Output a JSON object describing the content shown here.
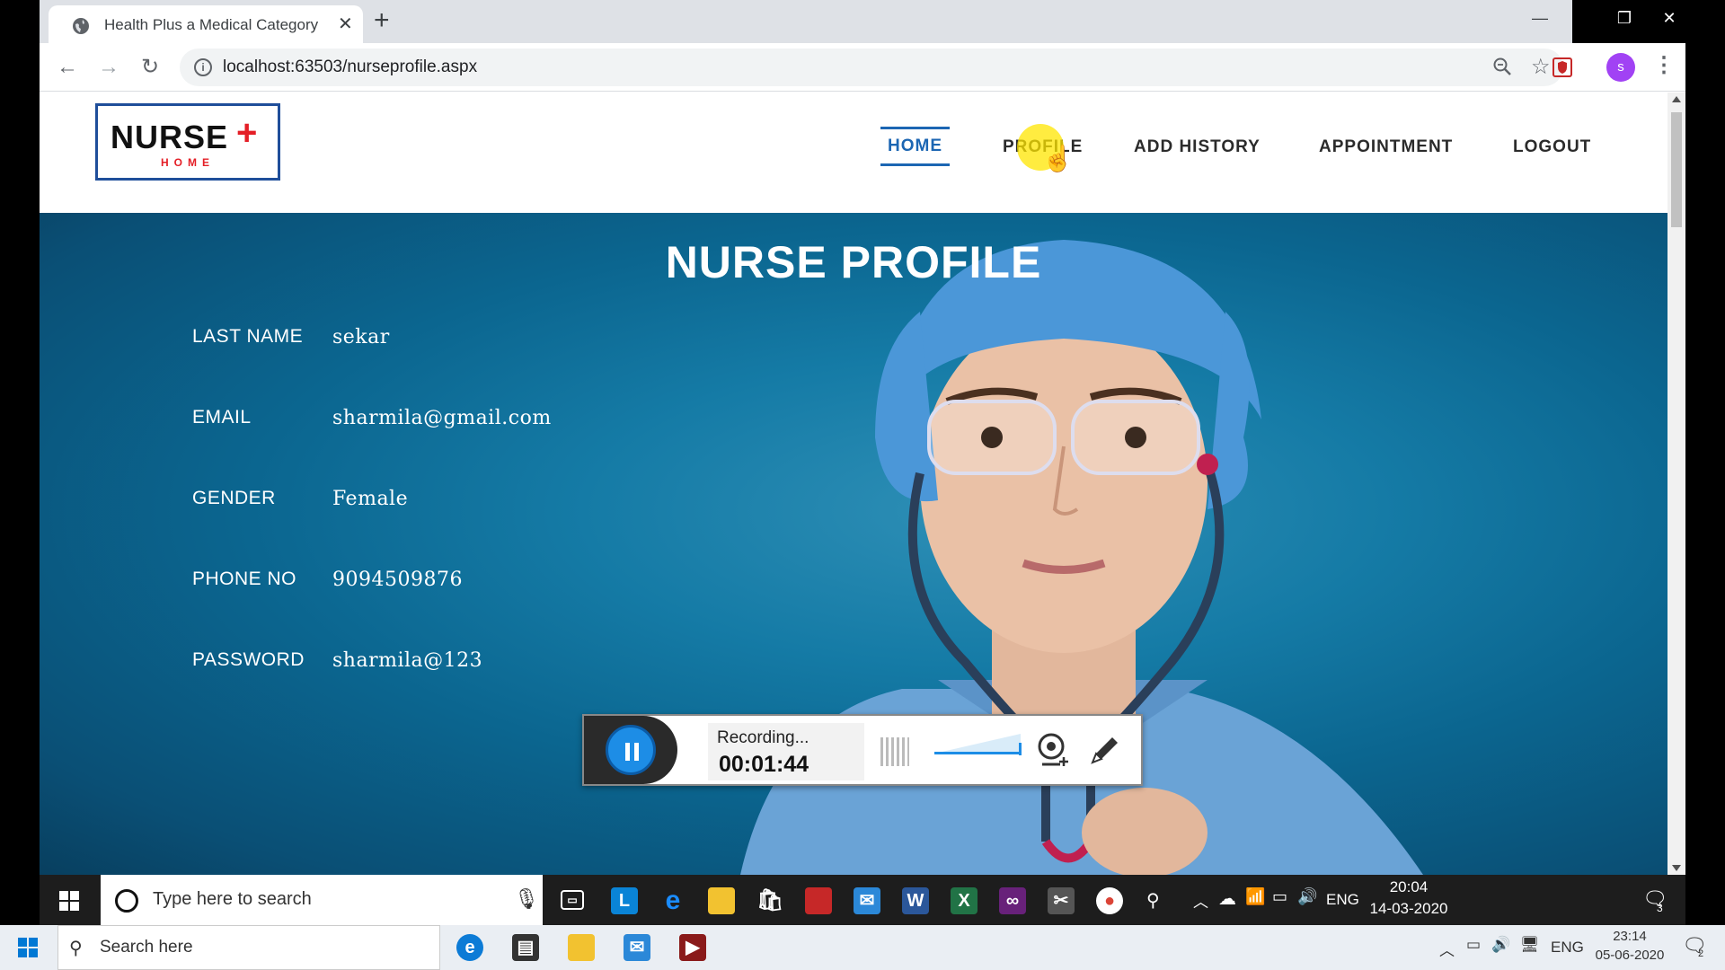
{
  "browser": {
    "tab_title": "Health Plus a Medical Category E",
    "url": "localhost:63503/nurseprofile.aspx",
    "avatar_letter": "s",
    "minimize": "—",
    "maximize": "❐",
    "close": "✕",
    "new_tab": "+",
    "tab_close": "✕"
  },
  "logo": {
    "word": "NURSE",
    "cross": "+",
    "sub": "HOME"
  },
  "nav": {
    "items": [
      {
        "label": "HOME",
        "active": true
      },
      {
        "label": "PROFILE"
      },
      {
        "label": "ADD HISTORY"
      },
      {
        "label": "APPOINTMENT"
      },
      {
        "label": "LOGOUT"
      }
    ]
  },
  "profile": {
    "title": "NURSE PROFILE",
    "fields": [
      {
        "label": "LAST NAME",
        "value": "sekar"
      },
      {
        "label": "EMAIL",
        "value": "sharmila@gmail.com"
      },
      {
        "label": "GENDER",
        "value": "Female"
      },
      {
        "label": "PHONE NO",
        "value": "9094509876"
      },
      {
        "label": "PASSWORD",
        "value": "sharmila@123"
      }
    ]
  },
  "recorder": {
    "status": "Recording...",
    "time": "00:01:44"
  },
  "taskbar_inner": {
    "search_placeholder": "Type here to search",
    "lang": "ENG",
    "time": "20:04",
    "date": "14-03-2020",
    "notifications": "3",
    "app_letter": "L"
  },
  "taskbar_outer": {
    "search_placeholder": "Search here",
    "lang": "ENG",
    "time": "23:14",
    "date": "05-06-2020",
    "notifications": "2"
  },
  "colors": {
    "accent": "#1c66b3",
    "logo_red": "#e41e26",
    "hero_blue": "#0b6690"
  }
}
